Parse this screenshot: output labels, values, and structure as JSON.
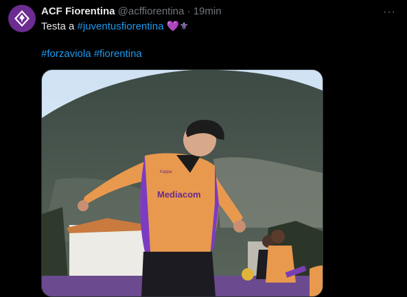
{
  "tweet": {
    "author_name": "ACF Fiorentina",
    "handle": "@acffiorentina",
    "separator": "·",
    "time": "19min",
    "more_glyph": "···",
    "text_prefix": "Testa a ",
    "hashtag1": "#juventusfiorentina",
    "heart_emoji": "💜",
    "fleur_emoji": "⚜",
    "hashtag2": "#forzaviola",
    "hashtag3": "#fiorentina"
  },
  "photo": {
    "shirt_sponsor": "Mediacom",
    "shirt_brand": "Kappa"
  },
  "colors": {
    "link": "#1d9bf0",
    "secondary_text": "#71767b",
    "brand_violet": "#6c2c91",
    "kit_orange": "#e8994e"
  }
}
